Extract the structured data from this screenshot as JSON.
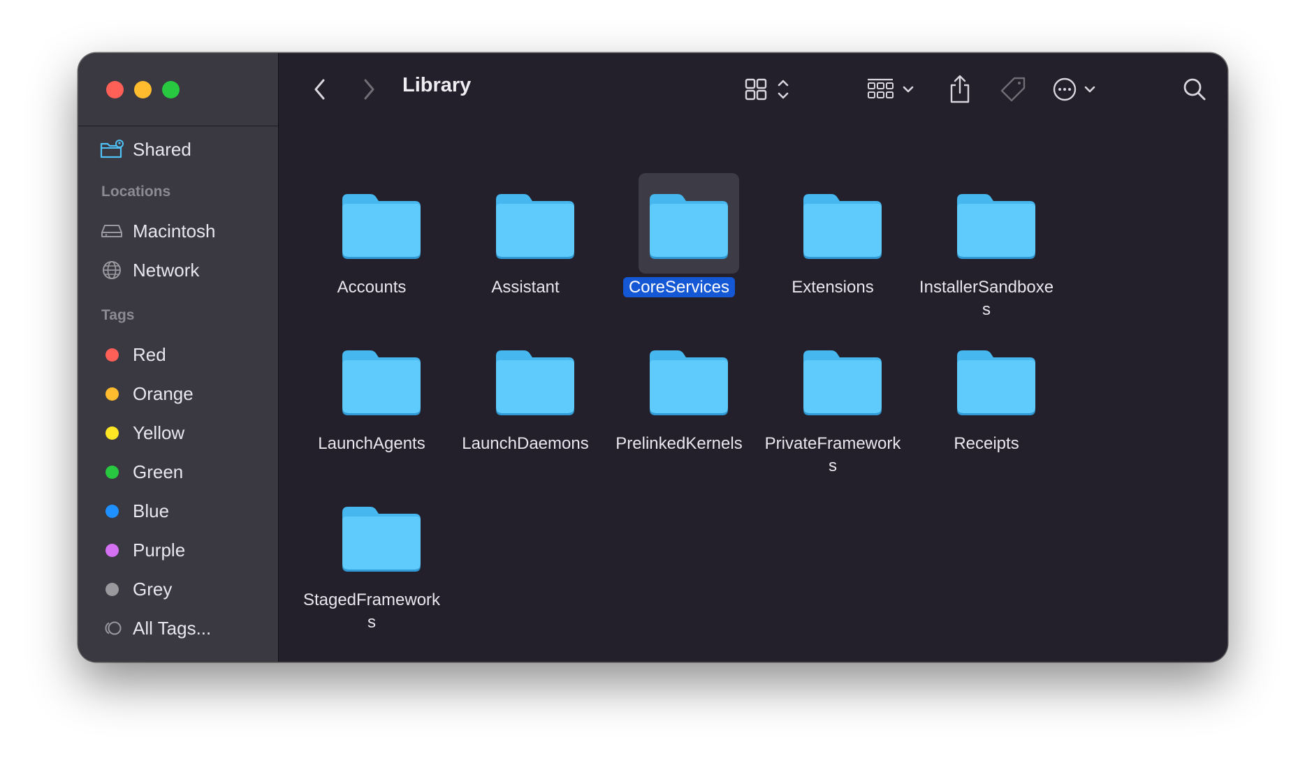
{
  "window": {
    "title": "Library"
  },
  "toolbar": {
    "back_icon": "chevron-left-icon",
    "forward_icon": "chevron-right-icon",
    "view_icon": "grid-view-icon",
    "group_icon": "group-by-icon",
    "share_icon": "share-icon",
    "tag_icon": "tag-icon",
    "more_icon": "ellipsis-circle-icon",
    "search_icon": "search-icon"
  },
  "sidebar": {
    "shared_label": "Shared",
    "locations_heading": "Locations",
    "locations": [
      {
        "label": "Macintosh",
        "icon": "hard-drive-icon"
      },
      {
        "label": "Network",
        "icon": "globe-icon"
      }
    ],
    "tags_heading": "Tags",
    "tags": [
      {
        "label": "Red",
        "color": "#fe5f57"
      },
      {
        "label": "Orange",
        "color": "#febc2e"
      },
      {
        "label": "Yellow",
        "color": "#fde725"
      },
      {
        "label": "Green",
        "color": "#28c840"
      },
      {
        "label": "Blue",
        "color": "#1e90ff"
      },
      {
        "label": "Purple",
        "color": "#d470f2"
      },
      {
        "label": "Grey",
        "color": "#9a999e"
      }
    ],
    "all_tags_label": "All Tags..."
  },
  "colors": {
    "folder": "#5ecbfc",
    "folder_tab": "#47b7ef",
    "selection": "#1558d6"
  },
  "folders": [
    {
      "name": [
        "Accounts"
      ],
      "selected": false
    },
    {
      "name": [
        "Assistant"
      ],
      "selected": false
    },
    {
      "name": [
        "CoreServices"
      ],
      "selected": true
    },
    {
      "name": [
        "Extensions"
      ],
      "selected": false
    },
    {
      "name": [
        "InstallerSandboxe",
        "s"
      ],
      "selected": false
    },
    {
      "name": [
        "LaunchAgents"
      ],
      "selected": false
    },
    {
      "name": [
        "LaunchDaemons"
      ],
      "selected": false
    },
    {
      "name": [
        "PrelinkedKernels"
      ],
      "selected": false
    },
    {
      "name": [
        "PrivateFramework",
        "s"
      ],
      "selected": false
    },
    {
      "name": [
        "Receipts"
      ],
      "selected": false
    },
    {
      "name": [
        "StagedFramework",
        "s"
      ],
      "selected": false
    }
  ]
}
